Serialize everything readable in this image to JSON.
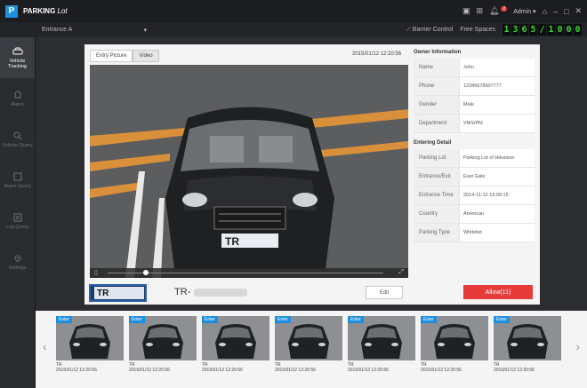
{
  "titlebar": {
    "logo": "P",
    "title_bold": "PARKING",
    "title_rest": "Lot",
    "user": "Admin",
    "notification_count": "2"
  },
  "subbar": {
    "entrance_value": "Entrance A",
    "barrier_control": "Barrier Control",
    "free_spaces_label": "Free Spaces",
    "free_spaces_digits": [
      "1",
      "3",
      "6",
      "5",
      "/",
      "1",
      "0",
      "0",
      "0"
    ]
  },
  "sidebar": {
    "items": [
      {
        "label": "Vehicle Tracking",
        "active": true
      },
      {
        "label": "Alarm",
        "active": false
      },
      {
        "label": "Vehicle Query",
        "active": false
      },
      {
        "label": "Alarm Query",
        "active": false
      },
      {
        "label": "Log Query",
        "active": false
      },
      {
        "label": "Settings",
        "active": false
      }
    ]
  },
  "main": {
    "tabs": [
      "Entry Picture",
      "Video"
    ],
    "timestamp": "2015/01/12 12:20:56",
    "plate_prefix": "TR",
    "plate_text_prefix": "TR-",
    "edit_label": "Edit",
    "allow_label": "Allow(11)"
  },
  "owner_info": {
    "title": "Owner Information",
    "rows": [
      {
        "k": "Name",
        "v": "John"
      },
      {
        "k": "Phone",
        "v": "12345678907777"
      },
      {
        "k": "Gender",
        "v": "Male"
      },
      {
        "k": "Department",
        "v": "VMS/PM"
      }
    ]
  },
  "entering_detail": {
    "title": "Entering Detail",
    "rows": [
      {
        "k": "Parking Lot",
        "v": "Parking Lot of Hikvision"
      },
      {
        "k": "Entrance/Exit",
        "v": "East Gate"
      },
      {
        "k": "Entrance Time",
        "v": "2014-11-12  19:00:15"
      },
      {
        "k": "Country",
        "v": "American"
      },
      {
        "k": "Parking Type",
        "v": "Whitelist"
      }
    ]
  },
  "thumbnails": {
    "items": [
      {
        "tag": "Enter",
        "plate": "TR",
        "time": "2015/01/12 12:20:56"
      },
      {
        "tag": "Enter",
        "plate": "TR",
        "time": "2015/01/12 12:20:56"
      },
      {
        "tag": "Enter",
        "plate": "TR",
        "time": "2015/01/12 12:20:56"
      },
      {
        "tag": "Enter",
        "plate": "TR",
        "time": "2015/01/12 12:20:56"
      },
      {
        "tag": "Enter",
        "plate": "TR",
        "time": "2015/01/12 12:20:56"
      },
      {
        "tag": "Enter",
        "plate": "TR",
        "time": "2015/01/12 12:20:56"
      },
      {
        "tag": "Enter",
        "plate": "TR",
        "time": "2015/01/12 12:20:56"
      }
    ]
  },
  "colors": {
    "accent_blue": "#1e8fe0",
    "allow_red": "#e53b3b",
    "digit_green": "#38d62b"
  }
}
